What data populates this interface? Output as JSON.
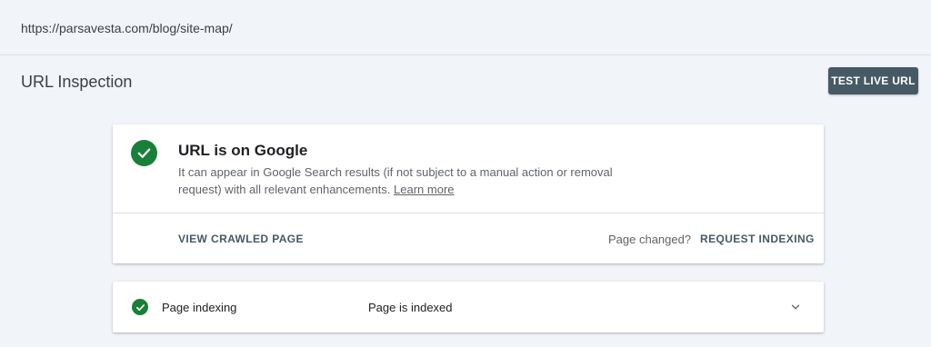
{
  "url_bar": {
    "url": "https://parsavesta.com/blog/site-map/"
  },
  "header": {
    "title": "URL Inspection",
    "test_live_button": "TEST LIVE URL"
  },
  "status_card": {
    "title": "URL is on Google",
    "description": "It can appear in Google Search results (if not subject to a manual action or removal request) with all relevant enhancements.",
    "learn_more": "Learn more",
    "view_crawled_page": "VIEW CRAWLED PAGE",
    "page_changed": "Page changed?",
    "request_indexing": "REQUEST INDEXING",
    "status_icon": "check-circle-icon"
  },
  "indexing_card": {
    "label": "Page indexing",
    "value": "Page is indexed",
    "status_icon": "check-circle-icon",
    "expand_icon": "chevron-down-icon"
  },
  "colors": {
    "success": "#188038",
    "button": "#455a64",
    "background": "#f1f4f9"
  }
}
